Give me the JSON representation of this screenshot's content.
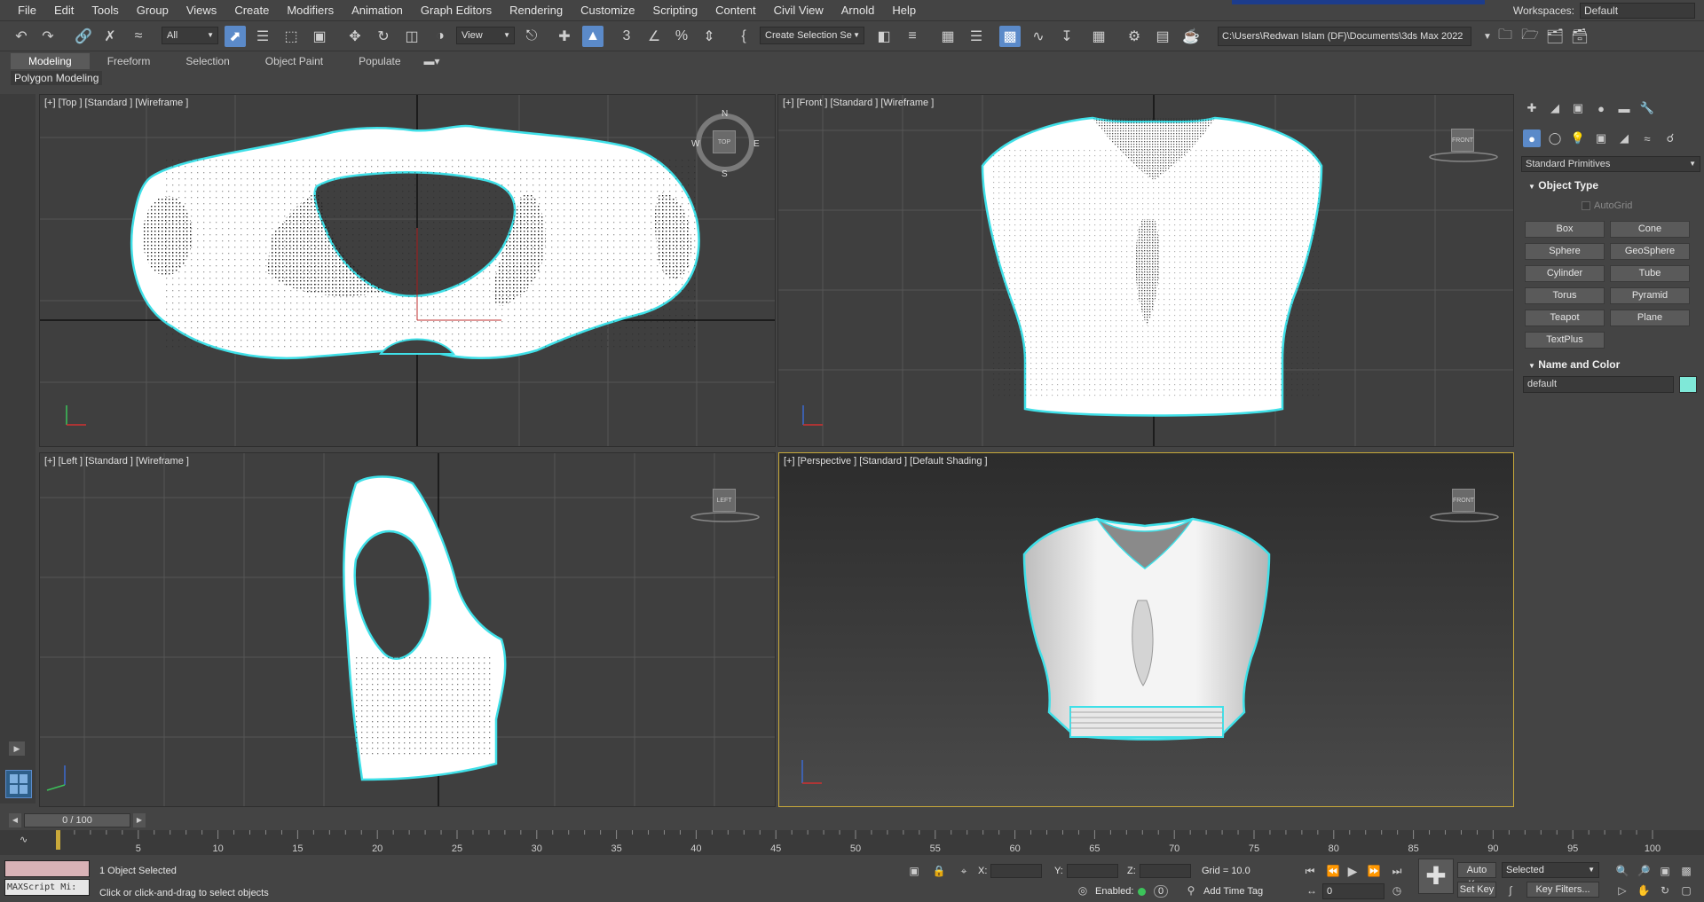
{
  "menu": {
    "items": [
      "File",
      "Edit",
      "Tools",
      "Group",
      "Views",
      "Create",
      "Modifiers",
      "Animation",
      "Graph Editors",
      "Rendering",
      "Customize",
      "Scripting",
      "Content",
      "Civil View",
      "Arnold",
      "Help"
    ],
    "workspaces_label": "Workspaces:",
    "workspaces_value": "Default"
  },
  "toolbar": {
    "filter_value": "All",
    "ref_coord_value": "View",
    "selection_set_value": "Create Selection Se",
    "project_path": "C:\\Users\\Redwan Islam (DF)\\Documents\\3ds Max 2022",
    "icons": [
      "undo-icon",
      "redo-icon",
      "link-icon",
      "unlink-icon",
      "bind-spacewarp-icon",
      "select-object-icon",
      "select-by-name-icon",
      "rectangle-selection-icon",
      "window-crossing-icon",
      "move-icon",
      "rotate-icon",
      "scale-icon",
      "place-icon"
    ]
  },
  "ribbon": {
    "tabs": [
      "Modeling",
      "Freeform",
      "Selection",
      "Object Paint",
      "Populate"
    ],
    "active_tab": "Modeling",
    "panel_label": "Polygon Modeling"
  },
  "viewports": {
    "top": {
      "label": "[+] [Top ] [Standard ] [Wireframe ]",
      "compass": {
        "n": "N",
        "s": "S",
        "e": "E",
        "w": "W",
        "cube": "TOP"
      }
    },
    "front": {
      "label": "[+] [Front ] [Standard ] [Wireframe ]",
      "cube": "FRONT"
    },
    "left": {
      "label": "[+] [Left ] [Standard ] [Wireframe ]",
      "cube": "LEFT"
    },
    "perspective": {
      "label": "[+] [Perspective ] [Standard ] [Default Shading ]",
      "cube": "FRONT"
    },
    "axis_labels": {
      "x": "x",
      "y": "y",
      "z": "z"
    }
  },
  "command_panel": {
    "category_value": "Standard Primitives",
    "object_type_title": "Object Type",
    "autogrid_label": "AutoGrid",
    "buttons": [
      "Box",
      "Cone",
      "Sphere",
      "GeoSphere",
      "Cylinder",
      "Tube",
      "Torus",
      "Pyramid",
      "Teapot",
      "Plane",
      "TextPlus"
    ],
    "name_color_title": "Name and Color",
    "name_value": "default",
    "color": "#7fe8d8"
  },
  "timeline": {
    "frame_counter": "0 / 100",
    "ticks": [
      "5",
      "10",
      "15",
      "20",
      "25",
      "30",
      "35",
      "40",
      "45",
      "50",
      "55",
      "60",
      "65",
      "70",
      "75",
      "80",
      "85",
      "90",
      "95",
      "100"
    ]
  },
  "status": {
    "maxscript_text": "MAXScript Mi:",
    "objects_selected": "1 Object Selected",
    "prompt": "Click or click-and-drag to select objects",
    "x_label": "X:",
    "y_label": "Y:",
    "z_label": "Z:",
    "grid": "Grid = 10.0",
    "enabled_label": "Enabled:",
    "enabled_count": "0",
    "add_time_tag": "Add Time Tag",
    "auto_key": "Auto Key",
    "set_key": "Set Key",
    "key_mode_value": "Selected",
    "key_filters": "Key Filters...",
    "frame_value": "0"
  },
  "colors": {
    "selection_outline": "#3fe0e8",
    "active_blue": "#5b8ac9",
    "perspective_border": "#c8a93a"
  }
}
